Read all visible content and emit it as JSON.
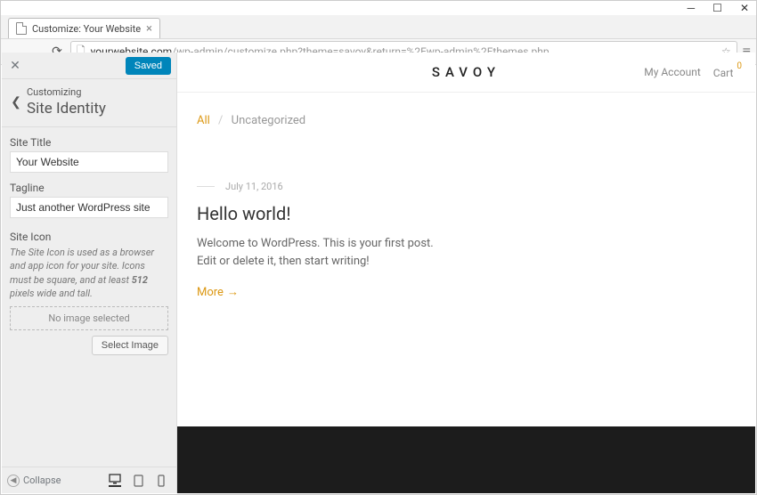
{
  "window": {
    "tab_title": "Customize: Your Website",
    "url_domain": "yourwebsite.com",
    "url_path": "/wp-admin/customize.php?theme=savoy&return=%2Fwp-admin%2Fthemes.php"
  },
  "customizer": {
    "saved_label": "Saved",
    "eyebrow": "Customizing",
    "section_title": "Site Identity",
    "site_title_label": "Site Title",
    "site_title_value": "Your Website",
    "tagline_label": "Tagline",
    "tagline_value": "Just another WordPress site",
    "site_icon_label": "Site Icon",
    "site_icon_desc_1": "The Site Icon is used as a browser and app icon for your site. Icons must be square, and at least ",
    "site_icon_desc_bold": "512",
    "site_icon_desc_2": " pixels wide and tall.",
    "no_image_text": "No image selected",
    "select_image_label": "Select Image",
    "collapse_label": "Collapse"
  },
  "preview": {
    "logo": "SAVOY",
    "my_account": "My Account",
    "cart_label": "Cart",
    "cart_count": "0",
    "breadcrumb_active": "All",
    "breadcrumb_sep": "/",
    "breadcrumb_current": "Uncategorized",
    "post_date": "July 11, 2016",
    "post_title": "Hello world!",
    "post_excerpt": "Welcome to WordPress. This is your first post. Edit or delete it, then start writing!",
    "more_label": "More"
  }
}
